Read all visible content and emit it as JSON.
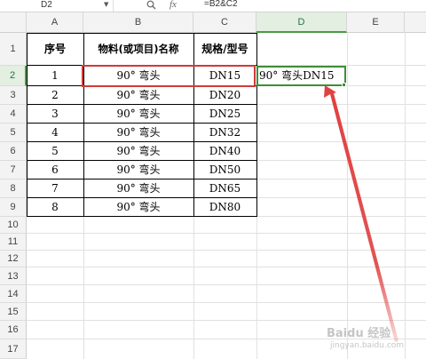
{
  "formula_bar": {
    "name_box": "D2",
    "formula": "=B2&C2"
  },
  "columns": [
    "A",
    "B",
    "C",
    "D",
    "E"
  ],
  "selected_column": "D",
  "rows": [
    "1",
    "2",
    "3",
    "4",
    "5",
    "6",
    "7",
    "8",
    "9",
    "10",
    "11",
    "12",
    "13",
    "14",
    "15",
    "16",
    "17"
  ],
  "selected_row": "2",
  "table": {
    "headers": [
      "序号",
      "物料(或项目)名称",
      "规格/型号"
    ],
    "records": [
      [
        "1",
        "90° 弯头",
        "DN15"
      ],
      [
        "2",
        "90° 弯头",
        "DN20"
      ],
      [
        "3",
        "90° 弯头",
        "DN25"
      ],
      [
        "4",
        "90° 弯头",
        "DN32"
      ],
      [
        "5",
        "90° 弯头",
        "DN40"
      ],
      [
        "6",
        "90° 弯头",
        "DN50"
      ],
      [
        "7",
        "90° 弯头",
        "DN65"
      ],
      [
        "8",
        "90° 弯头",
        "DN80"
      ]
    ]
  },
  "cell_d2": "90° 弯头DN15",
  "colors": {
    "selection_green": "#3c8f37",
    "highlight_red": "#d03a3a",
    "arrow_red": "#e04040"
  },
  "watermark": {
    "text": "Baidu 经验",
    "url": "jingyan.baidu.com"
  }
}
